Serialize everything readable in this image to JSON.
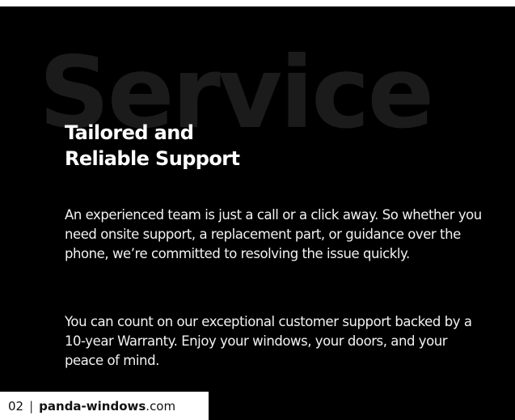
{
  "watermark": "Service",
  "heading": {
    "line1": "Tailored and",
    "line2": "Reliable Support"
  },
  "paragraphs": [
    "An experienced team is just a call or a click away. So whether you need onsite support, a replacement part, or guidance over the phone, we’re committed to resolving the issue quickly.",
    "You can count on our exceptional customer support backed by a 10-year Warranty. Enjoy your windows, your doors, and your peace of mind."
  ],
  "footer": {
    "page_number": "02",
    "separator": "|",
    "brand": "panda-windows",
    "domain_suffix": ".com"
  },
  "colors": {
    "panel_background": "#000000",
    "watermark": "#1b1b1b",
    "text": "#ffffff",
    "footer_background": "#ffffff",
    "footer_text": "#111111"
  }
}
